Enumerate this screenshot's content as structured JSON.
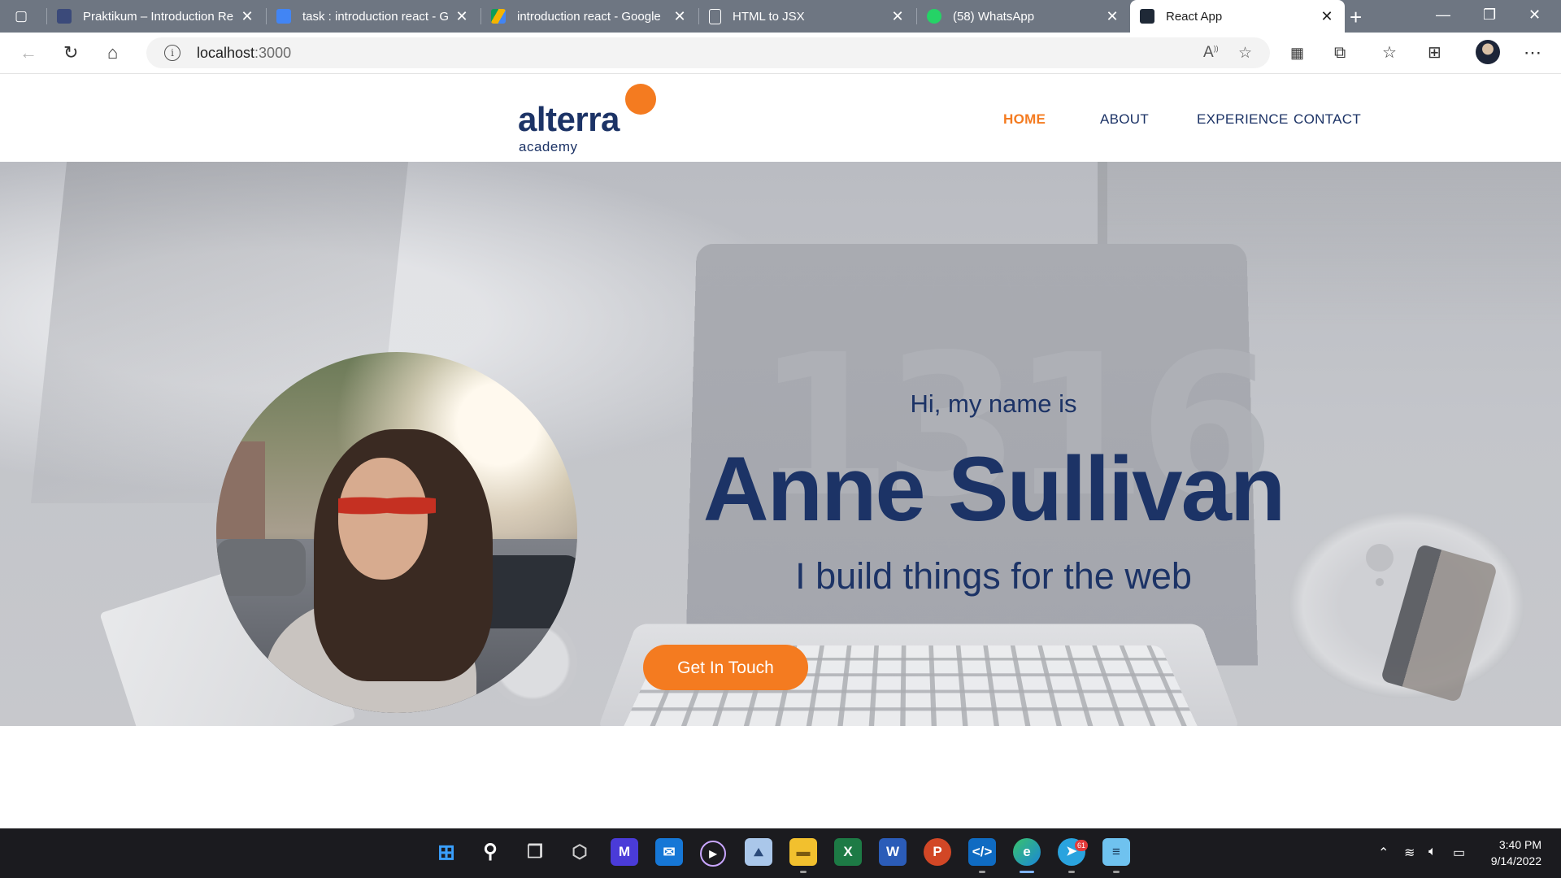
{
  "browser": {
    "tabs": [
      {
        "title": "Praktikum – Introduction Re",
        "icon": "alterra-favicon-icon",
        "color": "#3b4a7a"
      },
      {
        "title": "task : introduction react - Go",
        "icon": "google-docs-icon",
        "color": "#4285f4"
      },
      {
        "title": "introduction react - Google",
        "icon": "google-drive-icon",
        "color": "#f4b400"
      },
      {
        "title": "HTML to JSX",
        "icon": "document-icon",
        "color": "#ffffff"
      },
      {
        "title": "(58) WhatsApp",
        "icon": "whatsapp-icon",
        "color": "#25d366"
      },
      {
        "title": "React App",
        "icon": "react-icon",
        "color": "#1f2937",
        "active": true
      }
    ],
    "address": {
      "host": "localhost",
      "port": ":3000"
    }
  },
  "site": {
    "logo": {
      "main": "alterra",
      "sub": "academy",
      "accent": "#f47b20",
      "primary": "#1c3366"
    },
    "nav": [
      {
        "label": "HOME",
        "active": true
      },
      {
        "label": "ABOUT"
      },
      {
        "label": "EXPERIENCE"
      },
      {
        "label": "CONTACT"
      }
    ],
    "hero": {
      "greeting": "Hi, my name is",
      "name": "Anne Sullivan",
      "tagline": "I build things for the web",
      "cta": "Get In Touch"
    }
  },
  "taskbar": {
    "apps": [
      "windows-start-icon",
      "search-icon",
      "task-view-icon",
      "unity-icon",
      "visual-studio-icon",
      "mail-icon",
      "media-player-icon",
      "photos-icon",
      "file-explorer-icon",
      "excel-icon",
      "word-icon",
      "powerpoint-icon",
      "vscode-icon",
      "edge-icon",
      "telegram-icon",
      "notepad-icon"
    ],
    "telegram_badge": "61",
    "time": "3:40 PM",
    "date": "9/14/2022"
  }
}
